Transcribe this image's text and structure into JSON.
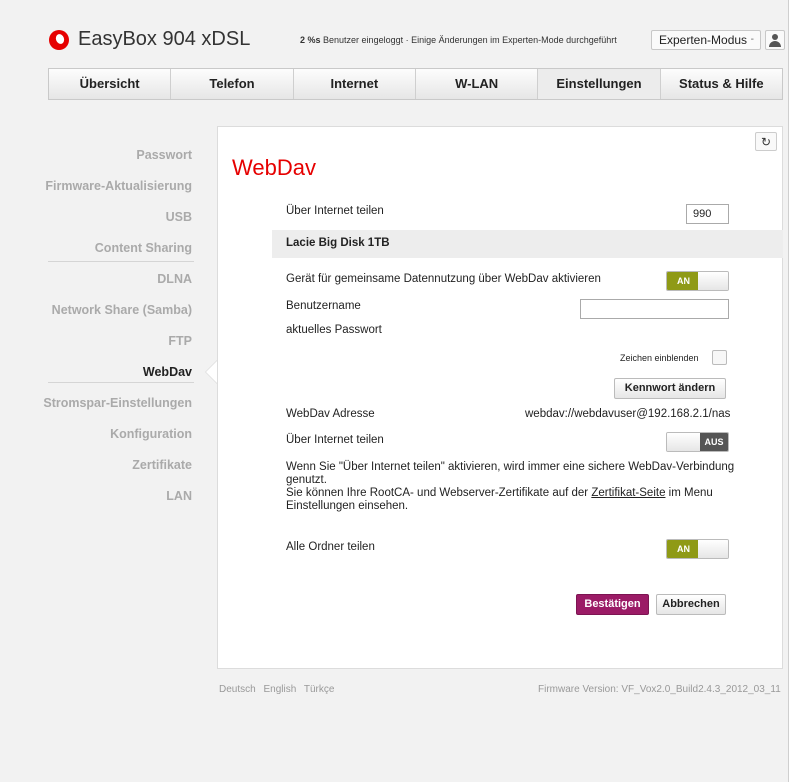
{
  "header": {
    "brand": "EasyBox 904 xDSL",
    "status_count": "2 %s",
    "status_text": "Benutzer eingeloggt · Einige Änderungen im Experten-Mode durchgeführt",
    "mode_label": "Experten-Modus",
    "mode_chevron": "-"
  },
  "tabs": [
    {
      "label": "Übersicht"
    },
    {
      "label": "Telefon"
    },
    {
      "label": "Internet"
    },
    {
      "label": "W-LAN"
    },
    {
      "label": "Einstellungen"
    },
    {
      "label": "Status & Hilfe"
    }
  ],
  "sidebar": {
    "items": [
      {
        "label": "Passwort"
      },
      {
        "label": "Firmware-Aktualisierung"
      },
      {
        "label": "USB"
      },
      {
        "label": "Content Sharing"
      },
      {
        "label": "DLNA"
      },
      {
        "label": "Network Share (Samba)"
      },
      {
        "label": "FTP"
      },
      {
        "label": "WebDav"
      },
      {
        "label": "Stromspar-Einstellungen"
      },
      {
        "label": "Konfiguration"
      },
      {
        "label": "Zertifikate"
      },
      {
        "label": "LAN"
      }
    ],
    "active": "WebDav"
  },
  "content": {
    "title": "WebDav",
    "refresh_icon": "↻",
    "share_internet_label": "Über Internet teilen",
    "port_value": "990",
    "disk_name": "Lacie Big Disk 1TB",
    "activate_label": "Gerät für gemeinsame Datennutzung über WebDav aktivieren",
    "activate_state": "AN",
    "username_label": "Benutzername",
    "username_value": "",
    "password_label": "aktuelles Passwort",
    "show_chars_label": "Zeichen einblenden",
    "change_password_button": "Kennwort ändern",
    "address_label": "WebDav Adresse",
    "address_value": "webdav://webdavuser@192.168.2.1/nas",
    "internet_share_label": "Über Internet teilen",
    "internet_share_state": "AUS",
    "info_line1": "Wenn Sie \"Über Internet teilen\" aktivieren, wird immer eine sichere WebDav-Verbindung genutzt.",
    "info_line2_prefix": "Sie können Ihre RootCA- und Webserver-Zertifikate auf der ",
    "info_link": "Zertifikat-Seite",
    "info_line2_suffix": " im Menu Einstellungen einsehen.",
    "share_all_label": "Alle Ordner teilen",
    "share_all_state": "AN",
    "confirm_button": "Bestätigen",
    "cancel_button": "Abbrechen"
  },
  "footer": {
    "languages": [
      "Deutsch",
      "English",
      "Türkçe"
    ],
    "firmware": "Firmware Version: VF_Vox2.0_Build2.4.3_2012_03_11"
  },
  "colors": {
    "brand_red": "#e60000",
    "toggle_on": "#8f9a16",
    "primary_button": "#9b1b66"
  }
}
